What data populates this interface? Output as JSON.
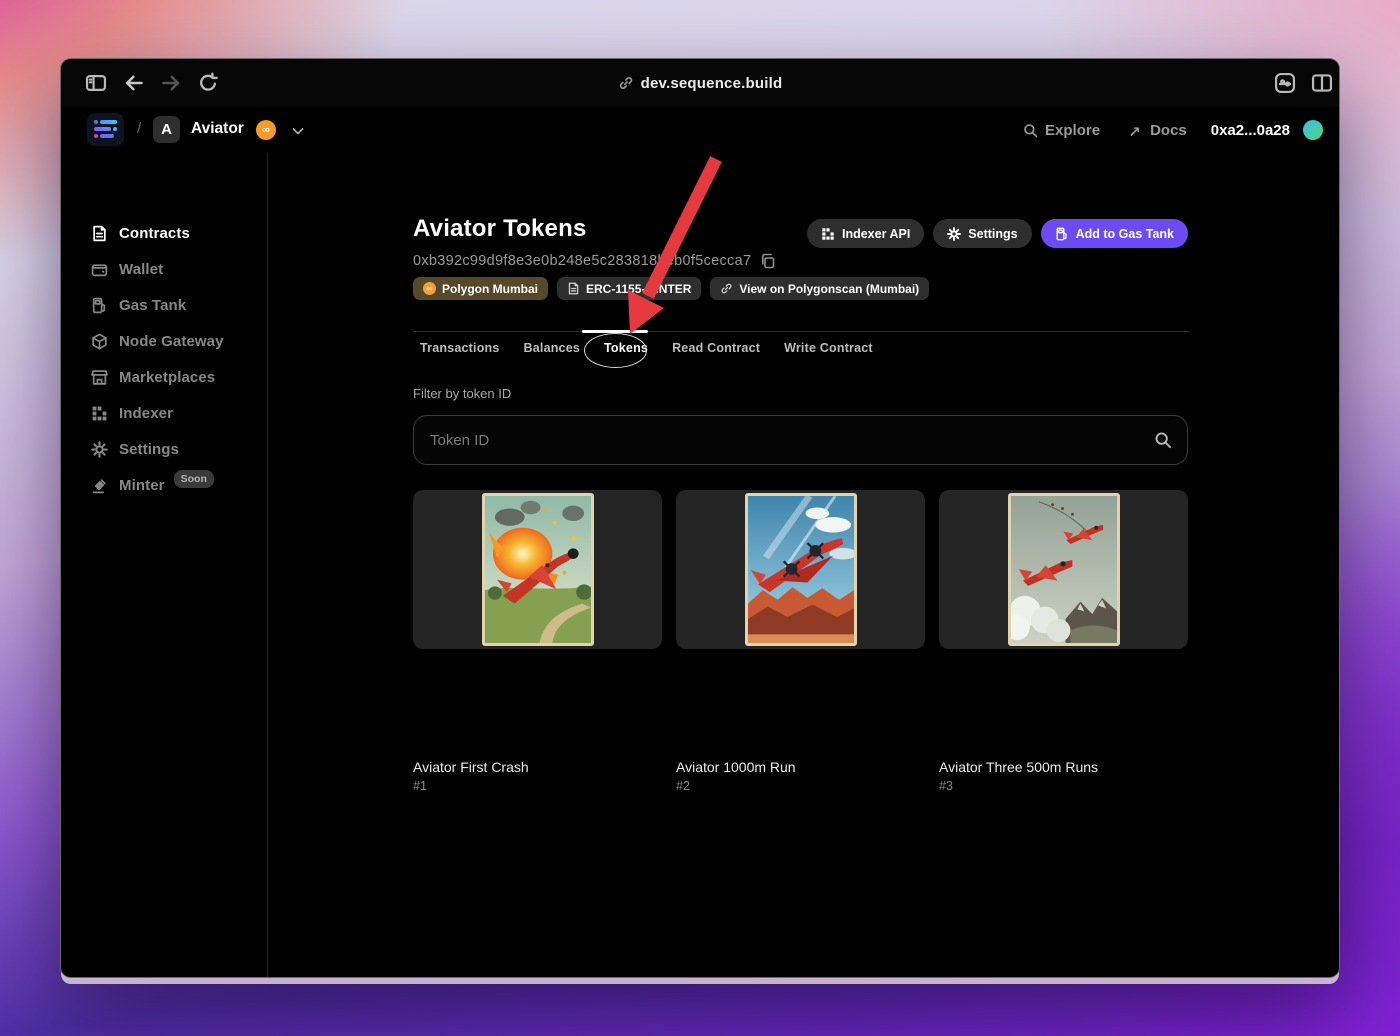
{
  "browser": {
    "url": "dev.sequence.build"
  },
  "header": {
    "separator": "/",
    "project_initial": "A",
    "project_name": "Aviator",
    "explore_label": "Explore",
    "docs_label": "Docs",
    "wallet_address": "0xa2...0a28"
  },
  "icons": {
    "polygon_glyph": "∞",
    "docs_arrow": "↗"
  },
  "sidebar": {
    "items": [
      {
        "label": "Contracts",
        "icon": "contracts-icon",
        "active": true
      },
      {
        "label": "Wallet",
        "icon": "wallet-icon",
        "active": false
      },
      {
        "label": "Gas Tank",
        "icon": "gas-tank-icon",
        "active": false
      },
      {
        "label": "Node Gateway",
        "icon": "node-gateway-icon",
        "active": false
      },
      {
        "label": "Marketplaces",
        "icon": "marketplaces-icon",
        "active": false
      },
      {
        "label": "Indexer",
        "icon": "indexer-icon",
        "active": false
      },
      {
        "label": "Settings",
        "icon": "settings-icon",
        "active": false
      },
      {
        "label": "Minter",
        "icon": "minter-icon",
        "active": false,
        "badge": "Soon"
      }
    ]
  },
  "main": {
    "title": "Aviator Tokens",
    "contract_address": "0xb392c99d9f8e3e0b248e5c283818beb0f5cecca7",
    "actions": {
      "indexer_api": "Indexer API",
      "settings": "Settings",
      "add_to_gas_tank": "Add to Gas Tank"
    },
    "badges": {
      "network": "Polygon Mumbai",
      "contract_type": "ERC-1155-MINTER",
      "explorer": "View on Polygonscan (Mumbai)"
    },
    "tabs": [
      {
        "label": "Transactions",
        "active": false
      },
      {
        "label": "Balances",
        "active": false
      },
      {
        "label": "Tokens",
        "active": true
      },
      {
        "label": "Read Contract",
        "active": false
      },
      {
        "label": "Write Contract",
        "active": false
      }
    ],
    "filter": {
      "label": "Filter by token ID",
      "placeholder": "Token ID"
    },
    "tokens": [
      {
        "name": "Aviator First Crash",
        "token_id": "#1"
      },
      {
        "name": "Aviator 1000m Run",
        "token_id": "#2"
      },
      {
        "name": "Aviator Three 500m Runs",
        "token_id": "#3"
      }
    ]
  },
  "colors": {
    "accent_purple": "#6c4cf2",
    "network_badge_bg": "#564929",
    "network_orange": "#f2a03b",
    "annotation_red": "#e63a41"
  }
}
